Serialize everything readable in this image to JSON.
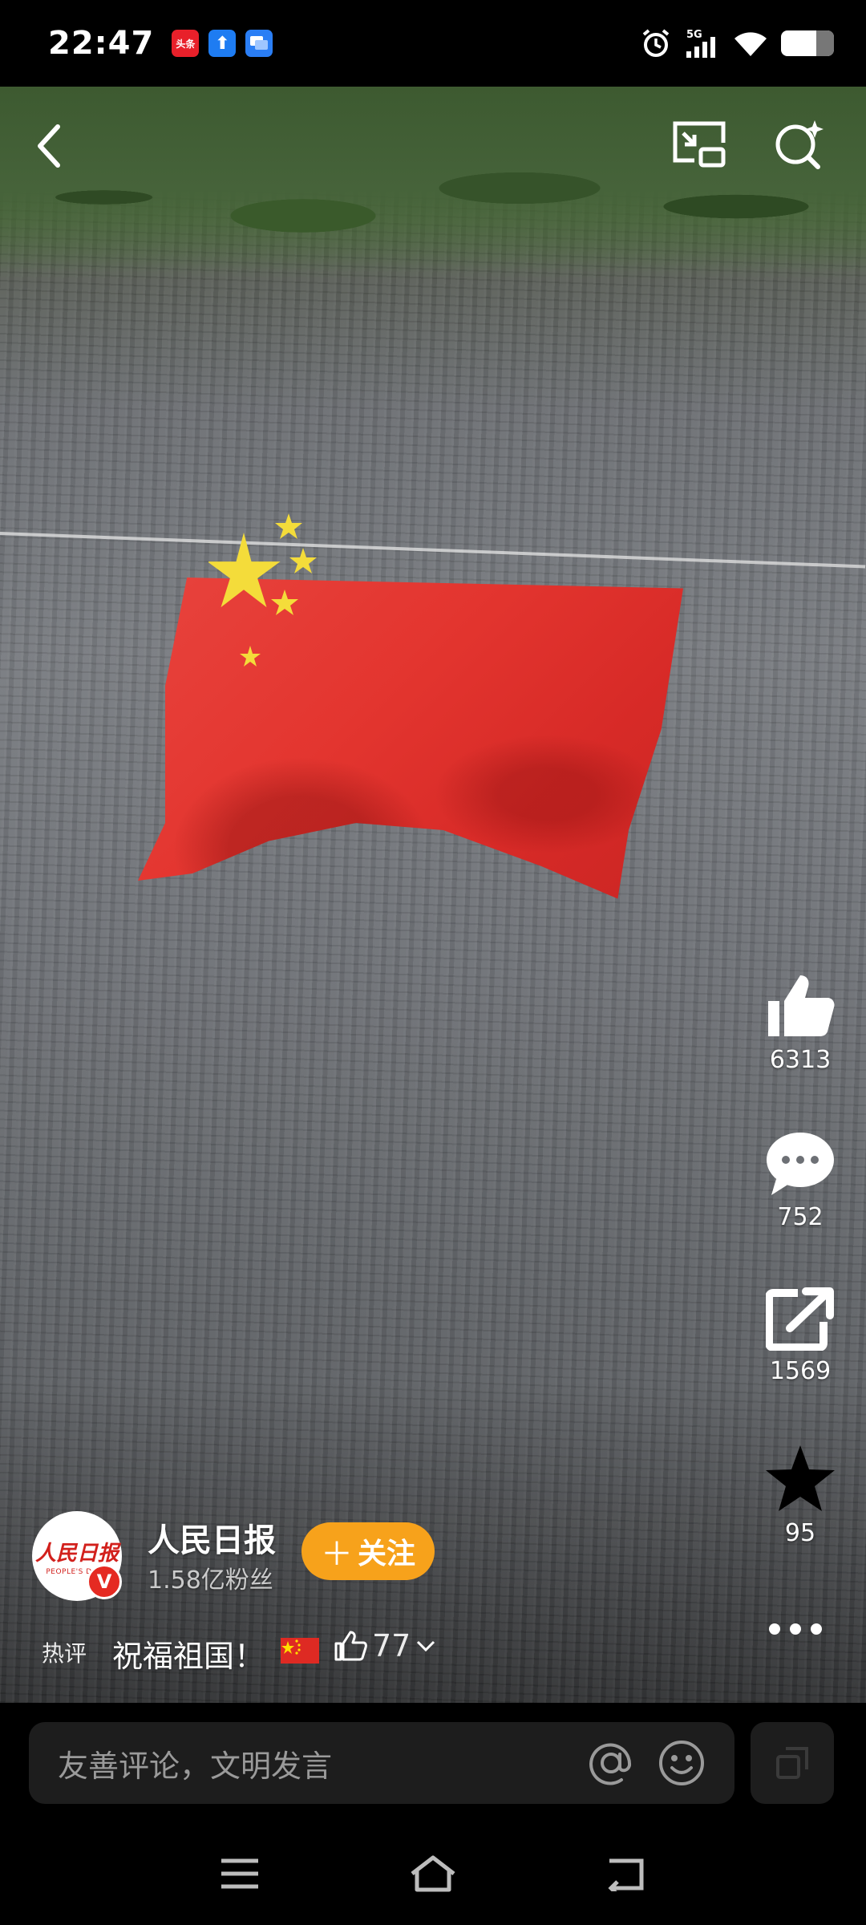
{
  "status_bar": {
    "time": "22:47",
    "notifications": [
      "toutiao-icon",
      "upload-icon",
      "message-icon"
    ],
    "toutiao_label": "头条",
    "network": "5G"
  },
  "video": {
    "description_icons": [
      "back-icon",
      "picture-in-picture-icon",
      "search-icon"
    ]
  },
  "actions": {
    "like_count": "6313",
    "comment_count": "752",
    "share_count": "1569",
    "favorite_count": "95"
  },
  "author": {
    "name": "人民日报",
    "fans": "1.58亿粉丝",
    "follow_label": "关注",
    "logo_text": "人民日报",
    "logo_sub": "PEOPLE'S DAILY",
    "verified_mark": "V"
  },
  "hot_comment": {
    "label": "热评",
    "text": "祝福祖国！",
    "likes": "77"
  },
  "comment_bar": {
    "placeholder": "友善评论，文明发言"
  },
  "colors": {
    "accent": "#f7a21b",
    "flag_red": "#de2a23",
    "verified_red": "#e52a22"
  }
}
